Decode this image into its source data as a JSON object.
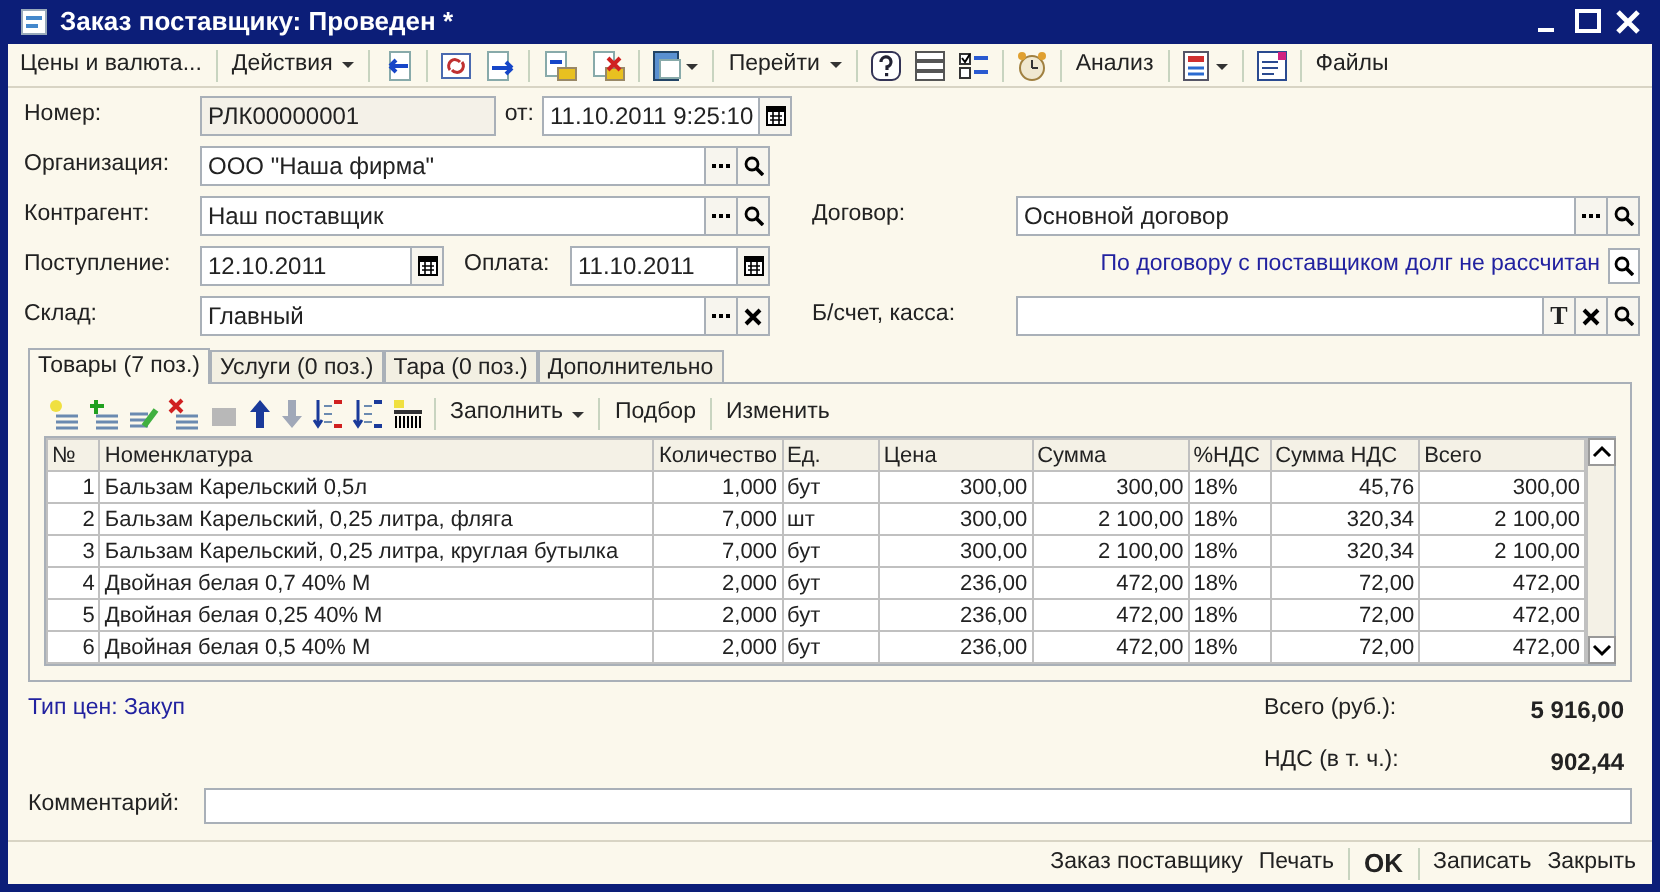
{
  "window": {
    "title": "Заказ поставщику: Проведен *"
  },
  "toolbar": [
    {
      "label": "Цены и валюта...",
      "kind": "button"
    },
    {
      "label": "Действия",
      "kind": "menu"
    },
    {
      "label": "Перейти",
      "kind": "menu"
    },
    {
      "label": "Анализ",
      "kind": "button"
    },
    {
      "label": "Файлы",
      "kind": "button"
    }
  ],
  "form": {
    "number": {
      "label": "Номер:",
      "value": "РЛК00000001"
    },
    "date": {
      "label": "от:",
      "value": "11.10.2011  9:25:10"
    },
    "organization": {
      "label": "Организация:",
      "value": "ООО \"Наша фирма\""
    },
    "counterparty": {
      "label": "Контрагент:",
      "value": "Наш поставщик"
    },
    "contract": {
      "label": "Договор:",
      "value": "Основной договор"
    },
    "receipt": {
      "label": "Поступление:",
      "value": "12.10.2011"
    },
    "payment": {
      "label": "Оплата:",
      "value": "11.10.2011"
    },
    "debt_link": "По договору с поставщиком долг не рассчитан",
    "warehouse": {
      "label": "Склад:",
      "value": "Главный"
    },
    "account": {
      "label": "Б/счет, касса:",
      "type_button": "T"
    }
  },
  "tabs": [
    {
      "label": "Товары (7 поз.)",
      "selected": true
    },
    {
      "label": "Услуги (0 поз.)",
      "selected": false
    },
    {
      "label": "Тара (0 поз.)",
      "selected": false
    },
    {
      "label": "Дополнительно",
      "selected": false
    }
  ],
  "table_toolbar": [
    {
      "label": "Заполнить",
      "kind": "menu"
    },
    {
      "label": "Подбор",
      "kind": "button"
    },
    {
      "label": "Изменить",
      "kind": "button"
    }
  ],
  "table": {
    "columns": [
      {
        "title": "№"
      },
      {
        "title": "Номенклатура"
      },
      {
        "title": "Количество"
      },
      {
        "title": "Ед."
      },
      {
        "title": "Цена"
      },
      {
        "title": "Сумма"
      },
      {
        "title": "%НДС"
      },
      {
        "title": "Сумма НДС"
      },
      {
        "title": "Всего"
      }
    ],
    "rows": [
      [
        "1",
        "Бальзам Карельский 0,5л",
        "1,000",
        "бут",
        "300,00",
        "300,00",
        "18%",
        "45,76",
        "300,00"
      ],
      [
        "2",
        "Бальзам Карельский, 0,25 литра, фляга",
        "7,000",
        "шт",
        "300,00",
        "2 100,00",
        "18%",
        "320,34",
        "2 100,00"
      ],
      [
        "3",
        "Бальзам Карельский, 0,25 литра, круглая бутылка",
        "7,000",
        "бут",
        "300,00",
        "2 100,00",
        "18%",
        "320,34",
        "2 100,00"
      ],
      [
        "4",
        "Двойная белая 0,7 40% М",
        "2,000",
        "бут",
        "236,00",
        "472,00",
        "18%",
        "72,00",
        "472,00"
      ],
      [
        "5",
        "Двойная белая 0,25 40% М",
        "2,000",
        "бут",
        "236,00",
        "472,00",
        "18%",
        "72,00",
        "472,00"
      ],
      [
        "6",
        "Двойная белая 0,5 40% М",
        "2,000",
        "бут",
        "236,00",
        "472,00",
        "18%",
        "72,00",
        "472,00"
      ]
    ]
  },
  "price_type": "Тип цен: Закуп",
  "totals": [
    {
      "label": "Всего (руб.):",
      "value": "5 916,00"
    },
    {
      "label": "НДС (в т. ч.):",
      "value": "902,44"
    }
  ],
  "comment": {
    "label": "Комментарий:"
  },
  "buttons": [
    {
      "label": "Заказ поставщику",
      "kind": "plain"
    },
    {
      "label": "Печать",
      "kind": "plain"
    },
    {
      "label": "OK",
      "kind": "default"
    },
    {
      "label": "Записать",
      "kind": "plain"
    },
    {
      "label": "Закрыть",
      "kind": "plain"
    }
  ]
}
